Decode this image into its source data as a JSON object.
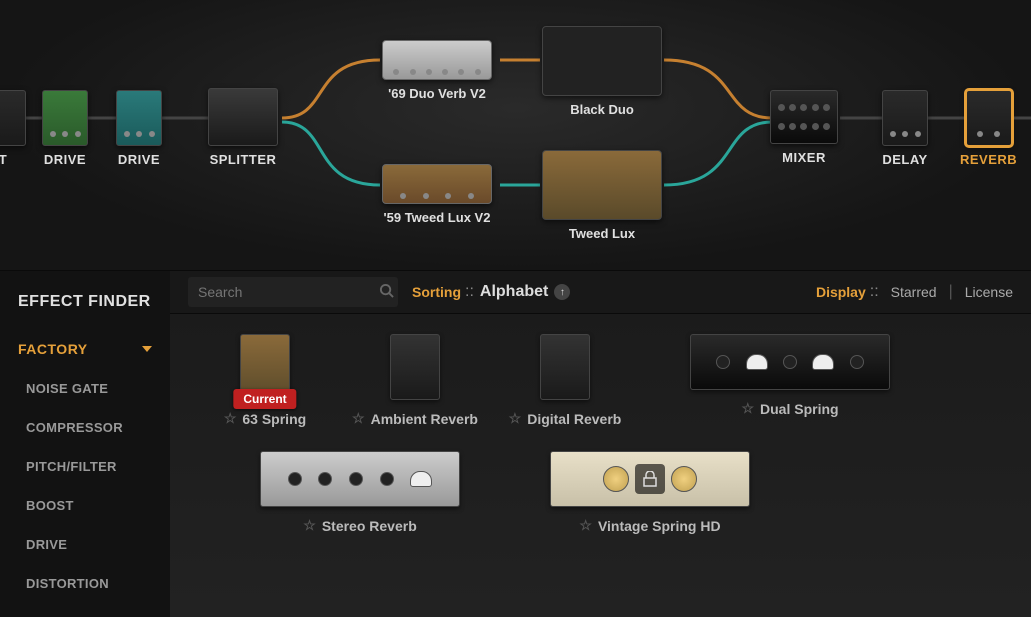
{
  "chain": {
    "drive1_label": "DRIVE",
    "drive2_label": "DRIVE",
    "splitter_label": "SPLITTER",
    "amp_top_label": "'69 Duo Verb V2",
    "cab_top_label": "Black Duo",
    "amp_bottom_label": "'59 Tweed Lux V2",
    "cab_bottom_label": "Tweed Lux",
    "mixer_label": "MIXER",
    "delay_label": "DELAY",
    "reverb_label": "REVERB"
  },
  "sidebar": {
    "title": "EFFECT FINDER",
    "category": "FACTORY",
    "items": [
      "NOISE GATE",
      "COMPRESSOR",
      "PITCH/FILTER",
      "BOOST",
      "DRIVE",
      "DISTORTION"
    ]
  },
  "toolbar": {
    "search_placeholder": "Search",
    "sorting_label": "Sorting",
    "sorting_value": "Alphabet",
    "display_label": "Display",
    "starred_label": "Starred",
    "license_label": "License"
  },
  "effects": {
    "current_badge": "Current",
    "row1": [
      {
        "name": "63 Spring",
        "current": true
      },
      {
        "name": "Ambient Reverb"
      },
      {
        "name": "Digital Reverb"
      },
      {
        "name": "Dual Spring",
        "rack": true
      }
    ],
    "row2": [
      {
        "name": "Stereo Reverb",
        "rack": true,
        "style": "silver"
      },
      {
        "name": "Vintage Spring HD",
        "rack": true,
        "style": "cream",
        "locked": true
      }
    ]
  }
}
